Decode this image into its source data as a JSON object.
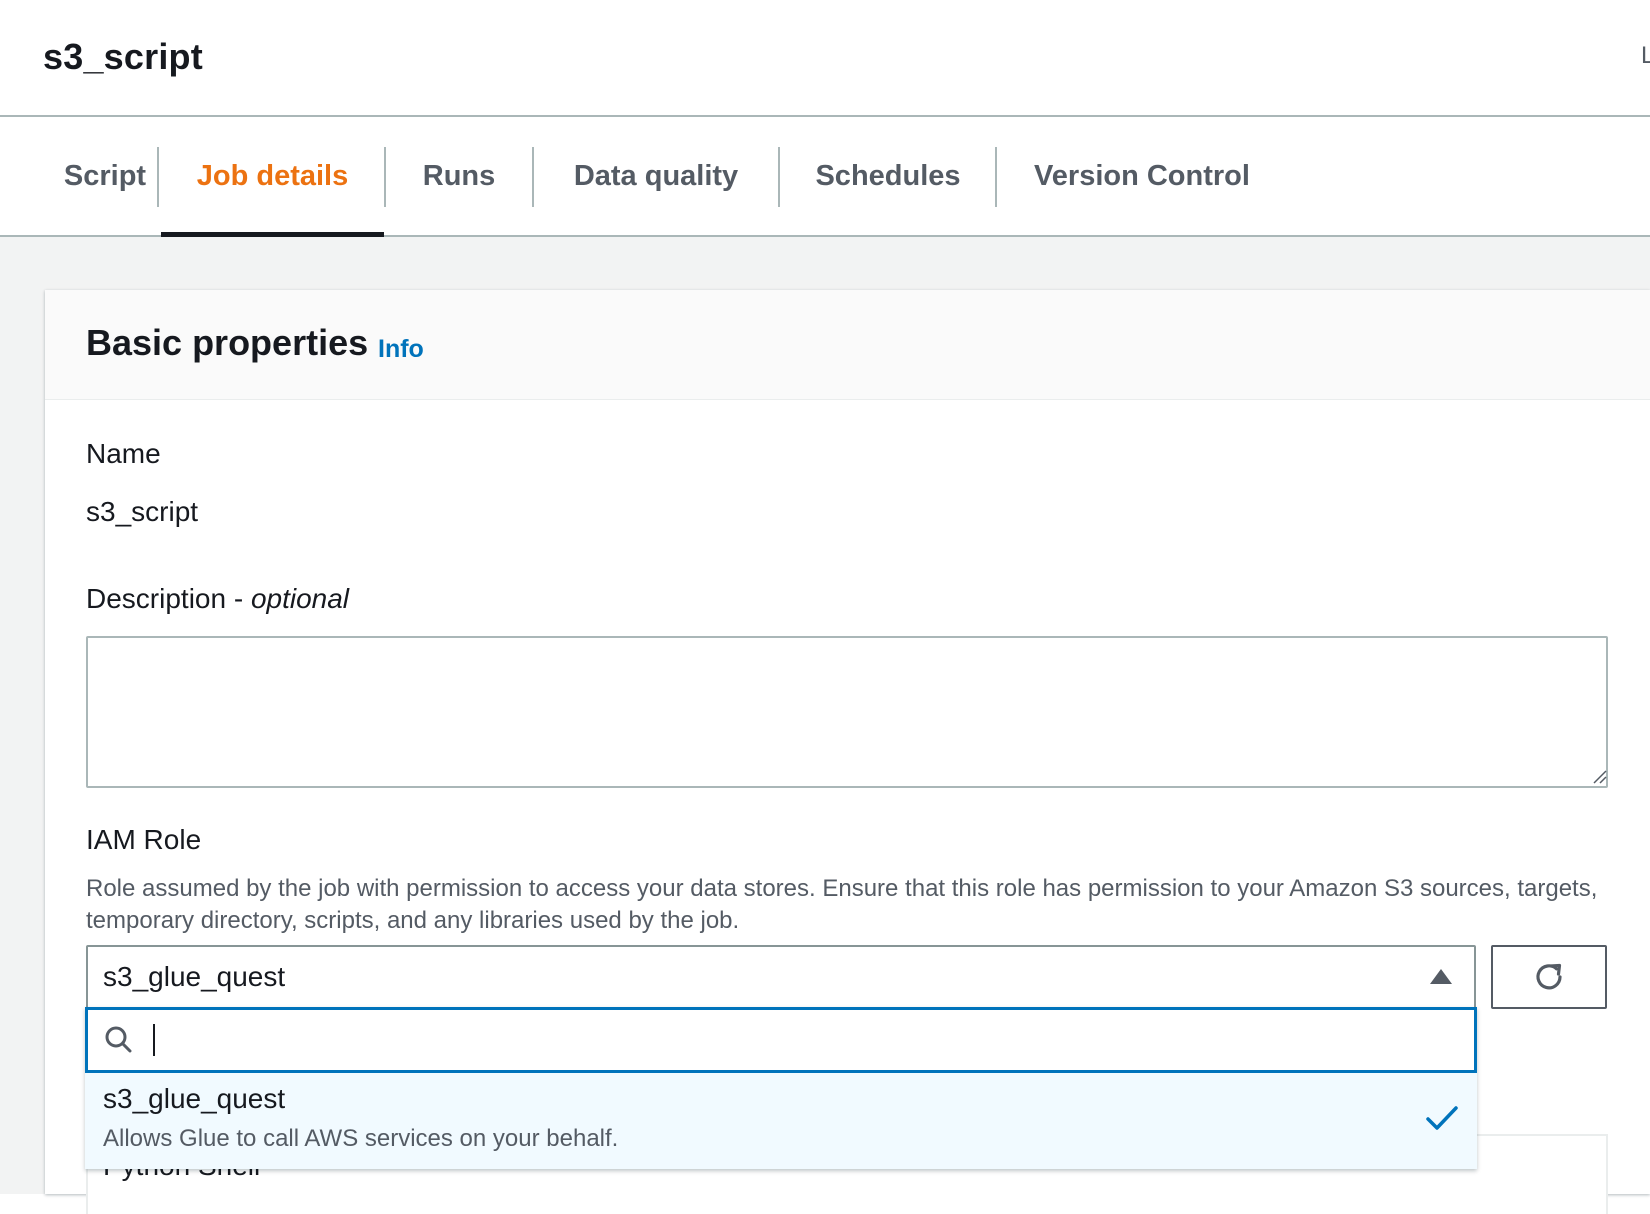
{
  "header": {
    "title": "s3_script",
    "edge_text": "L"
  },
  "tabs": [
    {
      "label": "Script"
    },
    {
      "label": "Job details",
      "active": true
    },
    {
      "label": "Runs"
    },
    {
      "label": "Data quality"
    },
    {
      "label": "Schedules"
    },
    {
      "label": "Version Control"
    }
  ],
  "panel": {
    "title": "Basic properties",
    "info_link": "Info",
    "name_label": "Name",
    "name_value": "s3_script",
    "description_label": "Description - ",
    "description_optional": "optional",
    "description_value": "",
    "iam_label": "IAM Role",
    "iam_description": "Role assumed by the job with permission to access your data stores. Ensure that this role has permission to your Amazon S3 sources, targets, temporary directory, scripts, and any libraries used by the job.",
    "iam_selected": "s3_glue_quest",
    "behind_field_text": "Python Shell"
  },
  "dropdown": {
    "search_value": "",
    "options": [
      {
        "label": "s3_glue_quest",
        "description": "Allows Glue to call AWS services on your behalf.",
        "selected": true
      }
    ]
  },
  "icons": {
    "refresh": "refresh-icon",
    "search": "search-icon",
    "check": "checkmark-icon",
    "caret": "caret-up-icon"
  },
  "colors": {
    "accent_tab": "#ec7211",
    "link": "#0073bb",
    "focus_border": "#0073bb",
    "selected_bg": "#f1faff"
  }
}
